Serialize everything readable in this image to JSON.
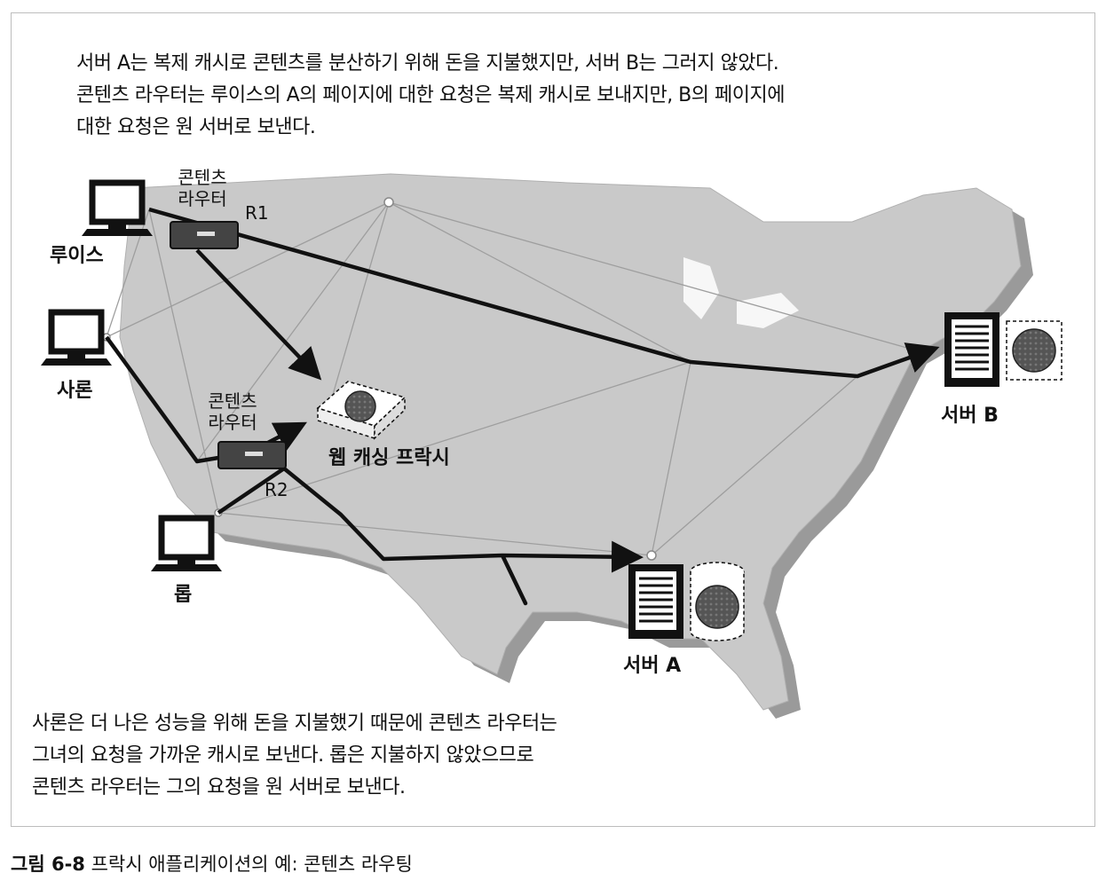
{
  "notes": {
    "top": [
      "서버 A는 복제 캐시로 콘텐츠를 분산하기 위해 돈을 지불했지만, 서버 B는 그러지 않았다.",
      "콘텐츠 라우터는 루이스의 A의 페이지에 대한 요청은 복제 캐시로 보내지만, B의 페이지에",
      "대한 요청은 원 서버로 보낸다."
    ],
    "bottom": [
      "사론은 더 나은 성능을 위해 돈을 지불했기 때문에 콘텐츠 라우터는",
      "그녀의 요청을 가까운 캐시로 보낸다. 롭은 지불하지 않았으므로",
      "콘텐츠 라우터는 그의 요청을 원 서버로 보낸다."
    ]
  },
  "labels": {
    "router1_line1": "콘텐츠",
    "router1_line2": "라우터",
    "router1_id": "R1",
    "router2_line1": "콘텐츠",
    "router2_line2": "라우터",
    "router2_id": "R2",
    "louis": "루이스",
    "sharon": "사론",
    "rob": "롭",
    "proxy": "웹 캐싱 프락시",
    "server_a": "서버 A",
    "server_b": "서버 B"
  },
  "caption": {
    "number": "그림 6-8",
    "text": "프락시 애플리케이션의 예: 콘텐츠 라우팅"
  },
  "colors": {
    "map_fill": "#c9c9c9",
    "map_shadow": "#9a9a9a",
    "network_line": "#9e9e9e",
    "route_line": "#111111",
    "router_fill": "#444444"
  }
}
